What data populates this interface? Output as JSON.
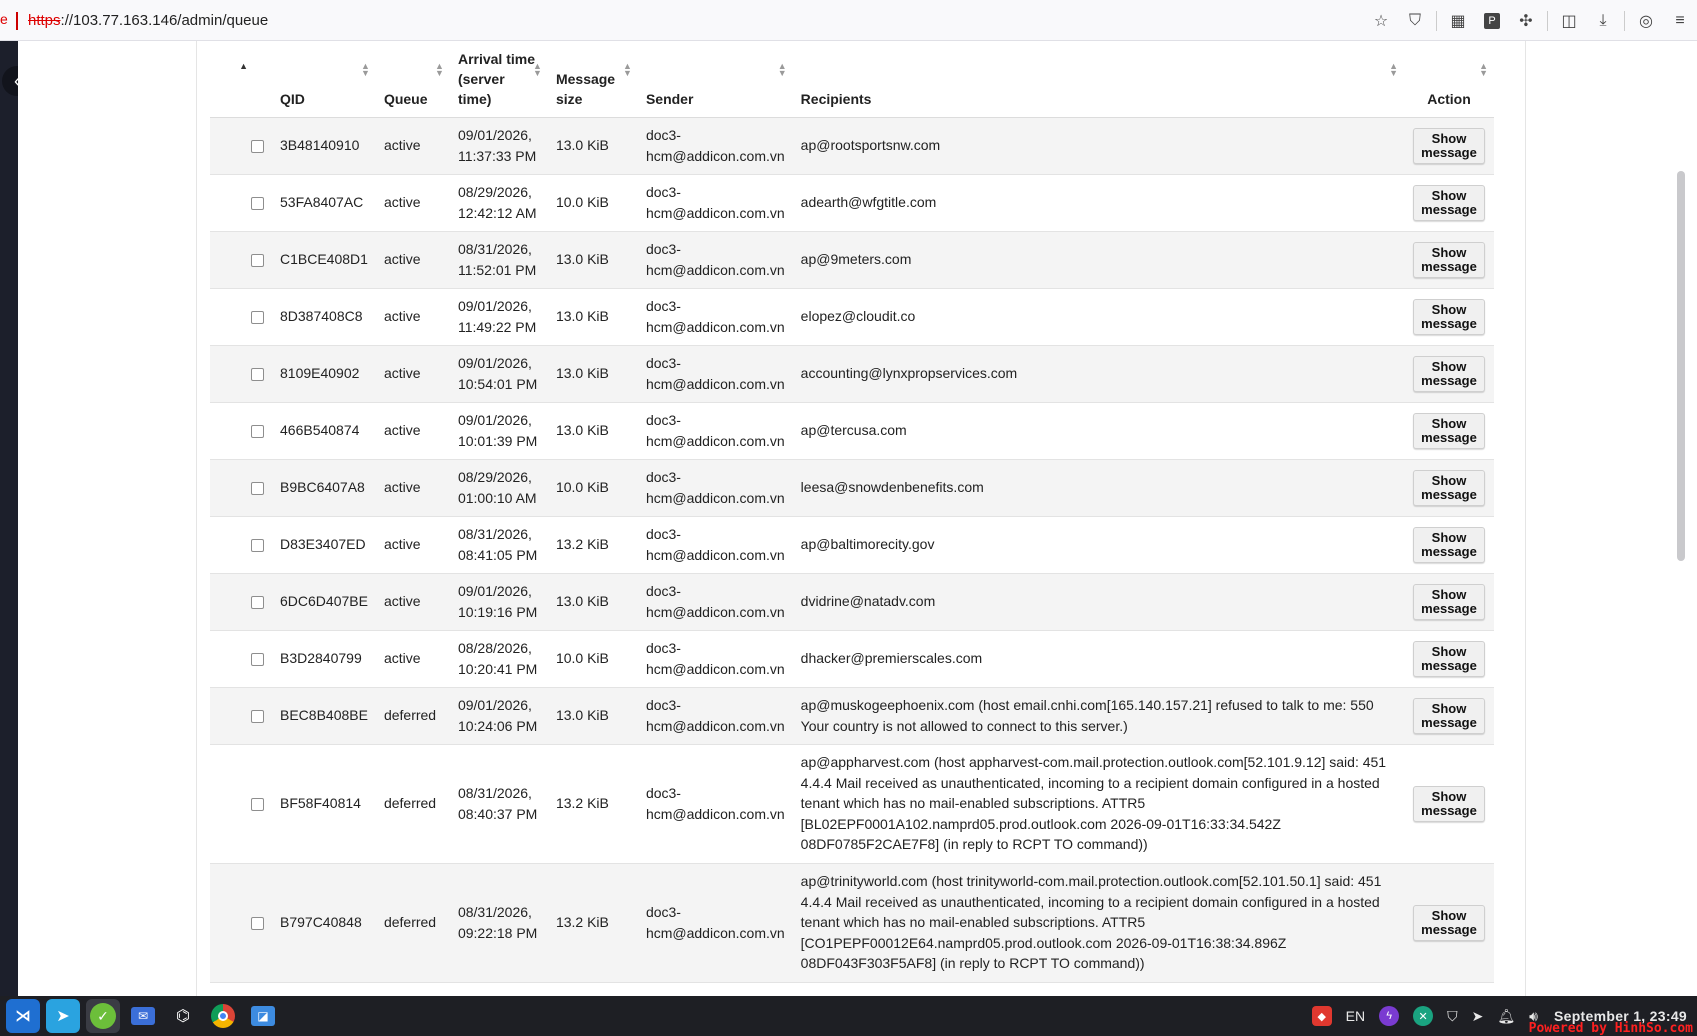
{
  "browser": {
    "url_protocol": "https",
    "url_rest": "://103.77.163.146/admin/queue",
    "icons": [
      "star-icon",
      "shield-icon",
      "qr-icon",
      "p-extension-icon",
      "puzzle-icon",
      "sidebar-icon",
      "download-icon",
      "account-icon",
      "menu-icon"
    ]
  },
  "table": {
    "headers": {
      "qid": "QID",
      "queue": "Queue",
      "arrival": "Arrival time (server time)",
      "size": "Message size",
      "sender": "Sender",
      "recipients": "Recipients",
      "action": "Action"
    },
    "button_label": "Show message",
    "rows": [
      {
        "qid": "3B48140910",
        "queue": "active",
        "arrival": "09/01/2026, 11:37:33 PM",
        "size": "13.0 KiB",
        "sender": "doc3-hcm@addicon.com.vn",
        "recipients": "ap@rootsportsnw.com"
      },
      {
        "qid": "53FA8407AC",
        "queue": "active",
        "arrival": "08/29/2026, 12:42:12 AM",
        "size": "10.0 KiB",
        "sender": "doc3-hcm@addicon.com.vn",
        "recipients": "adearth@wfgtitle.com"
      },
      {
        "qid": "C1BCE408D1",
        "queue": "active",
        "arrival": "08/31/2026, 11:52:01 PM",
        "size": "13.0 KiB",
        "sender": "doc3-hcm@addicon.com.vn",
        "recipients": "ap@9meters.com"
      },
      {
        "qid": "8D387408C8",
        "queue": "active",
        "arrival": "09/01/2026, 11:49:22 PM",
        "size": "13.0 KiB",
        "sender": "doc3-hcm@addicon.com.vn",
        "recipients": "elopez@cloudit.co"
      },
      {
        "qid": "8109E40902",
        "queue": "active",
        "arrival": "09/01/2026, 10:54:01 PM",
        "size": "13.0 KiB",
        "sender": "doc3-hcm@addicon.com.vn",
        "recipients": "accounting@lynxpropservices.com"
      },
      {
        "qid": "466B540874",
        "queue": "active",
        "arrival": "09/01/2026, 10:01:39 PM",
        "size": "13.0 KiB",
        "sender": "doc3-hcm@addicon.com.vn",
        "recipients": "ap@tercusa.com"
      },
      {
        "qid": "B9BC6407A8",
        "queue": "active",
        "arrival": "08/29/2026, 01:00:10 AM",
        "size": "10.0 KiB",
        "sender": "doc3-hcm@addicon.com.vn",
        "recipients": "leesa@snowdenbenefits.com"
      },
      {
        "qid": "D83E3407ED",
        "queue": "active",
        "arrival": "08/31/2026, 08:41:05 PM",
        "size": "13.2 KiB",
        "sender": "doc3-hcm@addicon.com.vn",
        "recipients": "ap@baltimorecity.gov"
      },
      {
        "qid": "6DC6D407BE",
        "queue": "active",
        "arrival": "09/01/2026, 10:19:16 PM",
        "size": "13.0 KiB",
        "sender": "doc3-hcm@addicon.com.vn",
        "recipients": "dvidrine@natadv.com"
      },
      {
        "qid": "B3D2840799",
        "queue": "active",
        "arrival": "08/28/2026, 10:20:41 PM",
        "size": "10.0 KiB",
        "sender": "doc3-hcm@addicon.com.vn",
        "recipients": "dhacker@premierscales.com"
      },
      {
        "qid": "BEC8B408BE",
        "queue": "deferred",
        "arrival": "09/01/2026, 10:24:06 PM",
        "size": "13.0 KiB",
        "sender": "doc3-hcm@addicon.com.vn",
        "recipients": "ap@muskogeephoenix.com (host email.cnhi.com[165.140.157.21] refused to talk to me: 550 Your country is not allowed to connect to this server.)"
      },
      {
        "qid": "BF58F40814",
        "queue": "deferred",
        "arrival": "08/31/2026, 08:40:37 PM",
        "size": "13.2 KiB",
        "sender": "doc3-hcm@addicon.com.vn",
        "recipients": "ap@appharvest.com (host appharvest-com.mail.protection.outlook.com[52.101.9.12] said: 451 4.4.4 Mail received as unauthenticated, incoming to a recipient domain configured in a hosted tenant which has no mail-enabled subscriptions. ATTR5 [BL02EPF0001A102.namprd05.prod.outlook.com 2026-09-01T16:33:34.542Z 08DF0785F2CAE7F8] (in reply to RCPT TO command))"
      },
      {
        "qid": "B797C40848",
        "queue": "deferred",
        "arrival": "08/31/2026, 09:22:18 PM",
        "size": "13.2 KiB",
        "sender": "doc3-hcm@addicon.com.vn",
        "recipients": "ap@trinityworld.com (host trinityworld-com.mail.protection.outlook.com[52.101.50.1] said: 451 4.4.4 Mail received as unauthenticated, incoming to a recipient domain configured in a hosted tenant which has no mail-enabled subscriptions. ATTR5 [CO1PEPF00012E64.namprd05.prod.outlook.com 2026-09-01T16:38:34.896Z 08DF043F303F5AF8] (in reply to RCPT TO command))"
      }
    ]
  },
  "taskbar": {
    "apps": [
      "vscode-icon",
      "telegram-icon",
      "app-icon",
      "mail-icon",
      "ai-icon",
      "chrome-icon",
      "remote-icon"
    ],
    "lang": "EN",
    "clock": "September  1, 23:49",
    "watermark": "Powered by HinhSo.com"
  }
}
